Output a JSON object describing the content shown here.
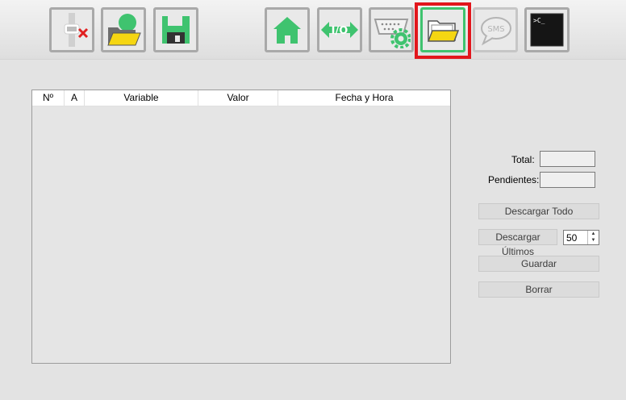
{
  "toolbar": {
    "buttons": [
      {
        "name": "disconnect",
        "icon": "plug-disconnect-icon"
      },
      {
        "name": "open-profile",
        "icon": "folder-user-icon"
      },
      {
        "name": "save",
        "icon": "floppy-disk-icon"
      },
      {
        "name": "home",
        "icon": "home-icon"
      },
      {
        "name": "io",
        "icon": "io-arrows-icon",
        "text": "I/O"
      },
      {
        "name": "serial-settings",
        "icon": "serial-port-gear-icon"
      },
      {
        "name": "datalog",
        "icon": "folder-open-icon",
        "selected": true
      },
      {
        "name": "sms",
        "icon": "sms-bubble-icon",
        "text": "SMS"
      },
      {
        "name": "terminal",
        "icon": "terminal-icon",
        "text": ">C_"
      }
    ]
  },
  "grid": {
    "columns": [
      "Nº",
      "A",
      "Variable",
      "Valor",
      "Fecha y Hora"
    ],
    "rows": []
  },
  "side": {
    "total_label": "Total:",
    "total_value": "",
    "pending_label": "Pendientes:",
    "pending_value": "",
    "download_all": "Descargar Todo",
    "download_last": "Descargar Últimos",
    "last_count": "50",
    "save": "Guardar",
    "delete": "Borrar"
  },
  "colors": {
    "accent_green": "#3fc36f",
    "highlight_red": "#e2161c",
    "folder_yellow": "#f5d612"
  }
}
